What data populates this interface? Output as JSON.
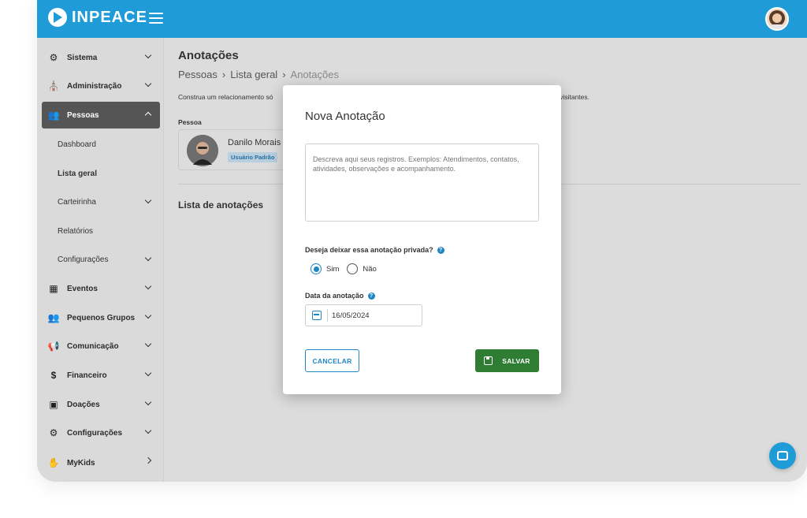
{
  "app": {
    "logo_text": "INPEACE"
  },
  "sidebar": {
    "items": [
      {
        "label": "Sistema",
        "icon": "gear-icon"
      },
      {
        "label": "Administração",
        "icon": "church-icon"
      },
      {
        "label": "Pessoas",
        "icon": "people-icon",
        "active": true
      },
      {
        "label": "Eventos",
        "icon": "calendar-icon"
      },
      {
        "label": "Pequenos Grupos",
        "icon": "people-icon"
      },
      {
        "label": "Comunicação",
        "icon": "megaphone-icon"
      },
      {
        "label": "Financeiro",
        "icon": "dollar-icon"
      },
      {
        "label": "Doações",
        "icon": "wallet-icon"
      },
      {
        "label": "Configurações",
        "icon": "gear-icon"
      },
      {
        "label": "MyKids",
        "icon": "hand-icon"
      }
    ],
    "sub_items": [
      "Dashboard",
      "Lista geral",
      "Carteirinha",
      "Relatórios",
      "Configurações"
    ]
  },
  "main": {
    "title": "Anotações",
    "breadcrumb": [
      "Pessoas",
      "Lista geral",
      "Anotações"
    ],
    "description_left": "Construa um relacionamento só",
    "description_right": "mentos e conversas com membros e visitantes.",
    "pessoa_label": "Pessoa",
    "person": {
      "name": "Danilo Morais",
      "badge": "Usuário Padrão"
    },
    "list_title": "Lista de anotações"
  },
  "modal": {
    "title": "Nova Anotação",
    "textarea_placeholder": "Descreva aqui seus registros. Exemplos: Atendimentos, contatos, atividades, observações e acompanhamento.",
    "private_question": "Deseja deixar essa anotação privada?",
    "radio_yes": "Sim",
    "radio_no": "Não",
    "radio_selected": "Sim",
    "date_label": "Data da anotação",
    "date_value": "16/05/2024",
    "cancel_label": "CANCELAR",
    "save_label": "SALVAR"
  },
  "colors": {
    "brand": "#1f9bd7",
    "accent": "#1f86c6",
    "save": "#2e7d32",
    "active_nav": "#555555"
  }
}
